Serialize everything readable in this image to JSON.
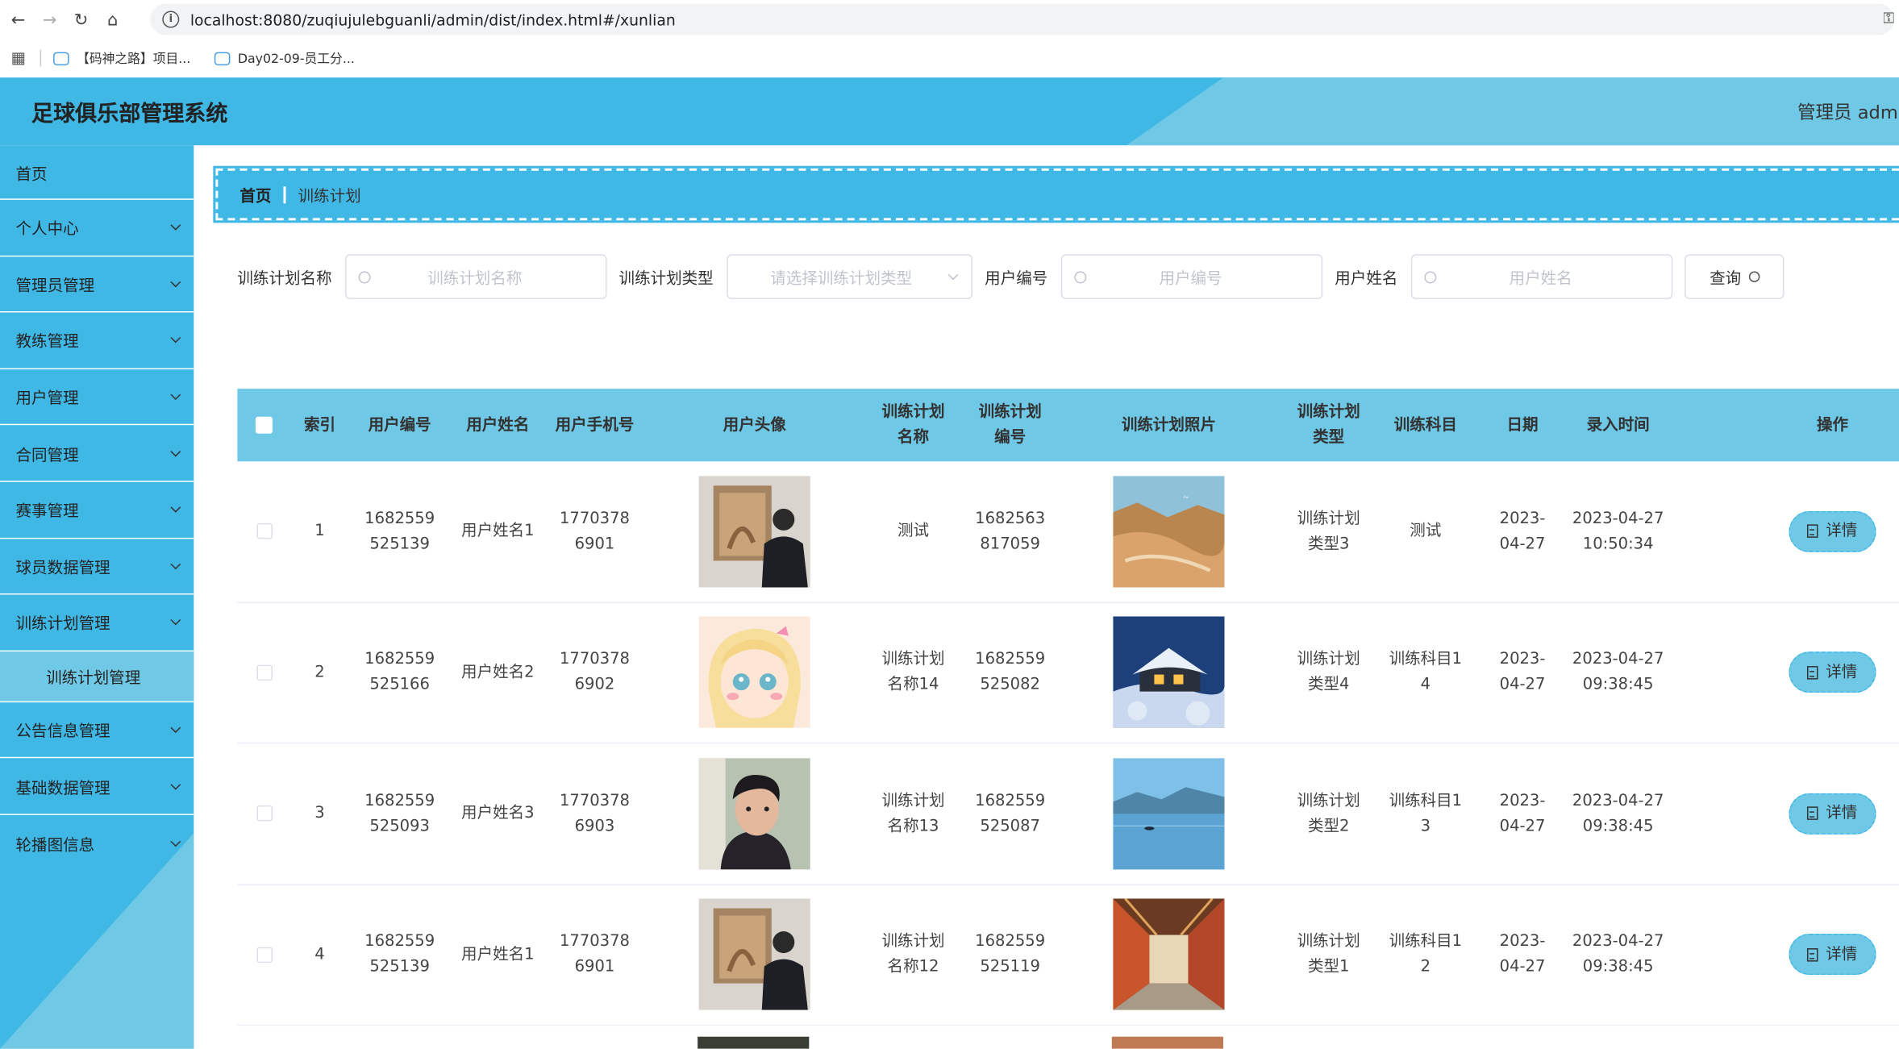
{
  "browser": {
    "url": "localhost:8080/zuqiujulebguanli/admin/dist/index.html#/xunlian",
    "bookmarks": [
      "【码神之路】项目...",
      "Day02-09-员工分..."
    ]
  },
  "header": {
    "title": "足球俱乐部管理系统",
    "admin": "管理员 admi"
  },
  "sidebar": {
    "items": [
      {
        "label": "首页"
      },
      {
        "label": "个人中心"
      },
      {
        "label": "管理员管理"
      },
      {
        "label": "教练管理"
      },
      {
        "label": "用户管理"
      },
      {
        "label": "合同管理"
      },
      {
        "label": "赛事管理"
      },
      {
        "label": "球员数据管理"
      },
      {
        "label": "训练计划管理"
      },
      {
        "label": "公告信息管理"
      },
      {
        "label": "基础数据管理"
      },
      {
        "label": "轮播图信息"
      }
    ],
    "active_sub": "训练计划管理"
  },
  "breadcrumb": {
    "home": "首页",
    "current": "训练计划"
  },
  "search": {
    "plan_name_label": "训练计划名称",
    "plan_name_placeholder": "训练计划名称",
    "plan_type_label": "训练计划类型",
    "plan_type_placeholder": "请选择训练计划类型",
    "user_no_label": "用户编号",
    "user_no_placeholder": "用户编号",
    "user_name_label": "用户姓名",
    "user_name_placeholder": "用户姓名",
    "query_label": "查询"
  },
  "table": {
    "columns": [
      "索引",
      "用户编号",
      "用户姓名",
      "用户手机号",
      "用户头像",
      "训练计划名称",
      "训练计划编号",
      "训练计划照片",
      "训练计划类型",
      "训练科目",
      "日期",
      "录入时间",
      "操作"
    ],
    "detail_label": "详情",
    "rows": [
      {
        "idx": "1",
        "user_no": "1682559525139",
        "user_name": "用户姓名1",
        "phone": "17703786901",
        "plan_name": "测试",
        "plan_no": "1682563817059",
        "plan_type": "训练计划类型3",
        "subject": "测试",
        "date": "2023-04-27",
        "time": "2023-04-27 10:50:34",
        "avatar": "portrait-back",
        "photo": "canyon"
      },
      {
        "idx": "2",
        "user_no": "1682559525166",
        "user_name": "用户姓名2",
        "phone": "17703786902",
        "plan_name": "训练计划名称14",
        "plan_no": "1682559525082",
        "plan_type": "训练计划类型4",
        "subject": "训练科目14",
        "date": "2023-04-27",
        "time": "2023-04-27 09:38:45",
        "avatar": "anime",
        "photo": "snow-house"
      },
      {
        "idx": "3",
        "user_no": "1682559525093",
        "user_name": "用户姓名3",
        "phone": "17703786903",
        "plan_name": "训练计划名称13",
        "plan_no": "1682559525087",
        "plan_type": "训练计划类型2",
        "subject": "训练科目13",
        "date": "2023-04-27",
        "time": "2023-04-27 09:38:45",
        "avatar": "young-man",
        "photo": "lake"
      },
      {
        "idx": "4",
        "user_no": "1682559525139",
        "user_name": "用户姓名1",
        "phone": "17703786901",
        "plan_name": "训练计划名称12",
        "plan_no": "1682559525119",
        "plan_type": "训练计划类型1",
        "subject": "训练科目12",
        "date": "2023-04-27",
        "time": "2023-04-27 09:38:45",
        "avatar": "portrait-back",
        "photo": "corridor"
      }
    ]
  }
}
